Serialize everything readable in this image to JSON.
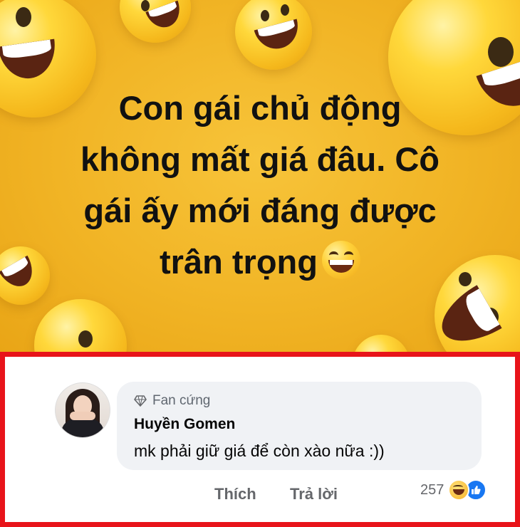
{
  "post": {
    "text_lines": [
      "Con gái chủ động",
      "không mất giá đâu. Cô",
      "gái ấy mới đáng được",
      "trân trọng"
    ],
    "inline_emoji": "grinning-squinting-face",
    "background_color": "#f1b425"
  },
  "comment": {
    "badge_icon": "gem-icon",
    "badge_label": "Fan cứng",
    "author": "Huyền Gomen",
    "text": "mk phải giữ giá để còn xào nữa :))",
    "actions": {
      "like": "Thích",
      "reply": "Trả lời"
    },
    "reaction_count": "257",
    "reaction_icons": [
      "haha-icon",
      "like-icon"
    ],
    "highlight_border_color": "#e8141a"
  }
}
